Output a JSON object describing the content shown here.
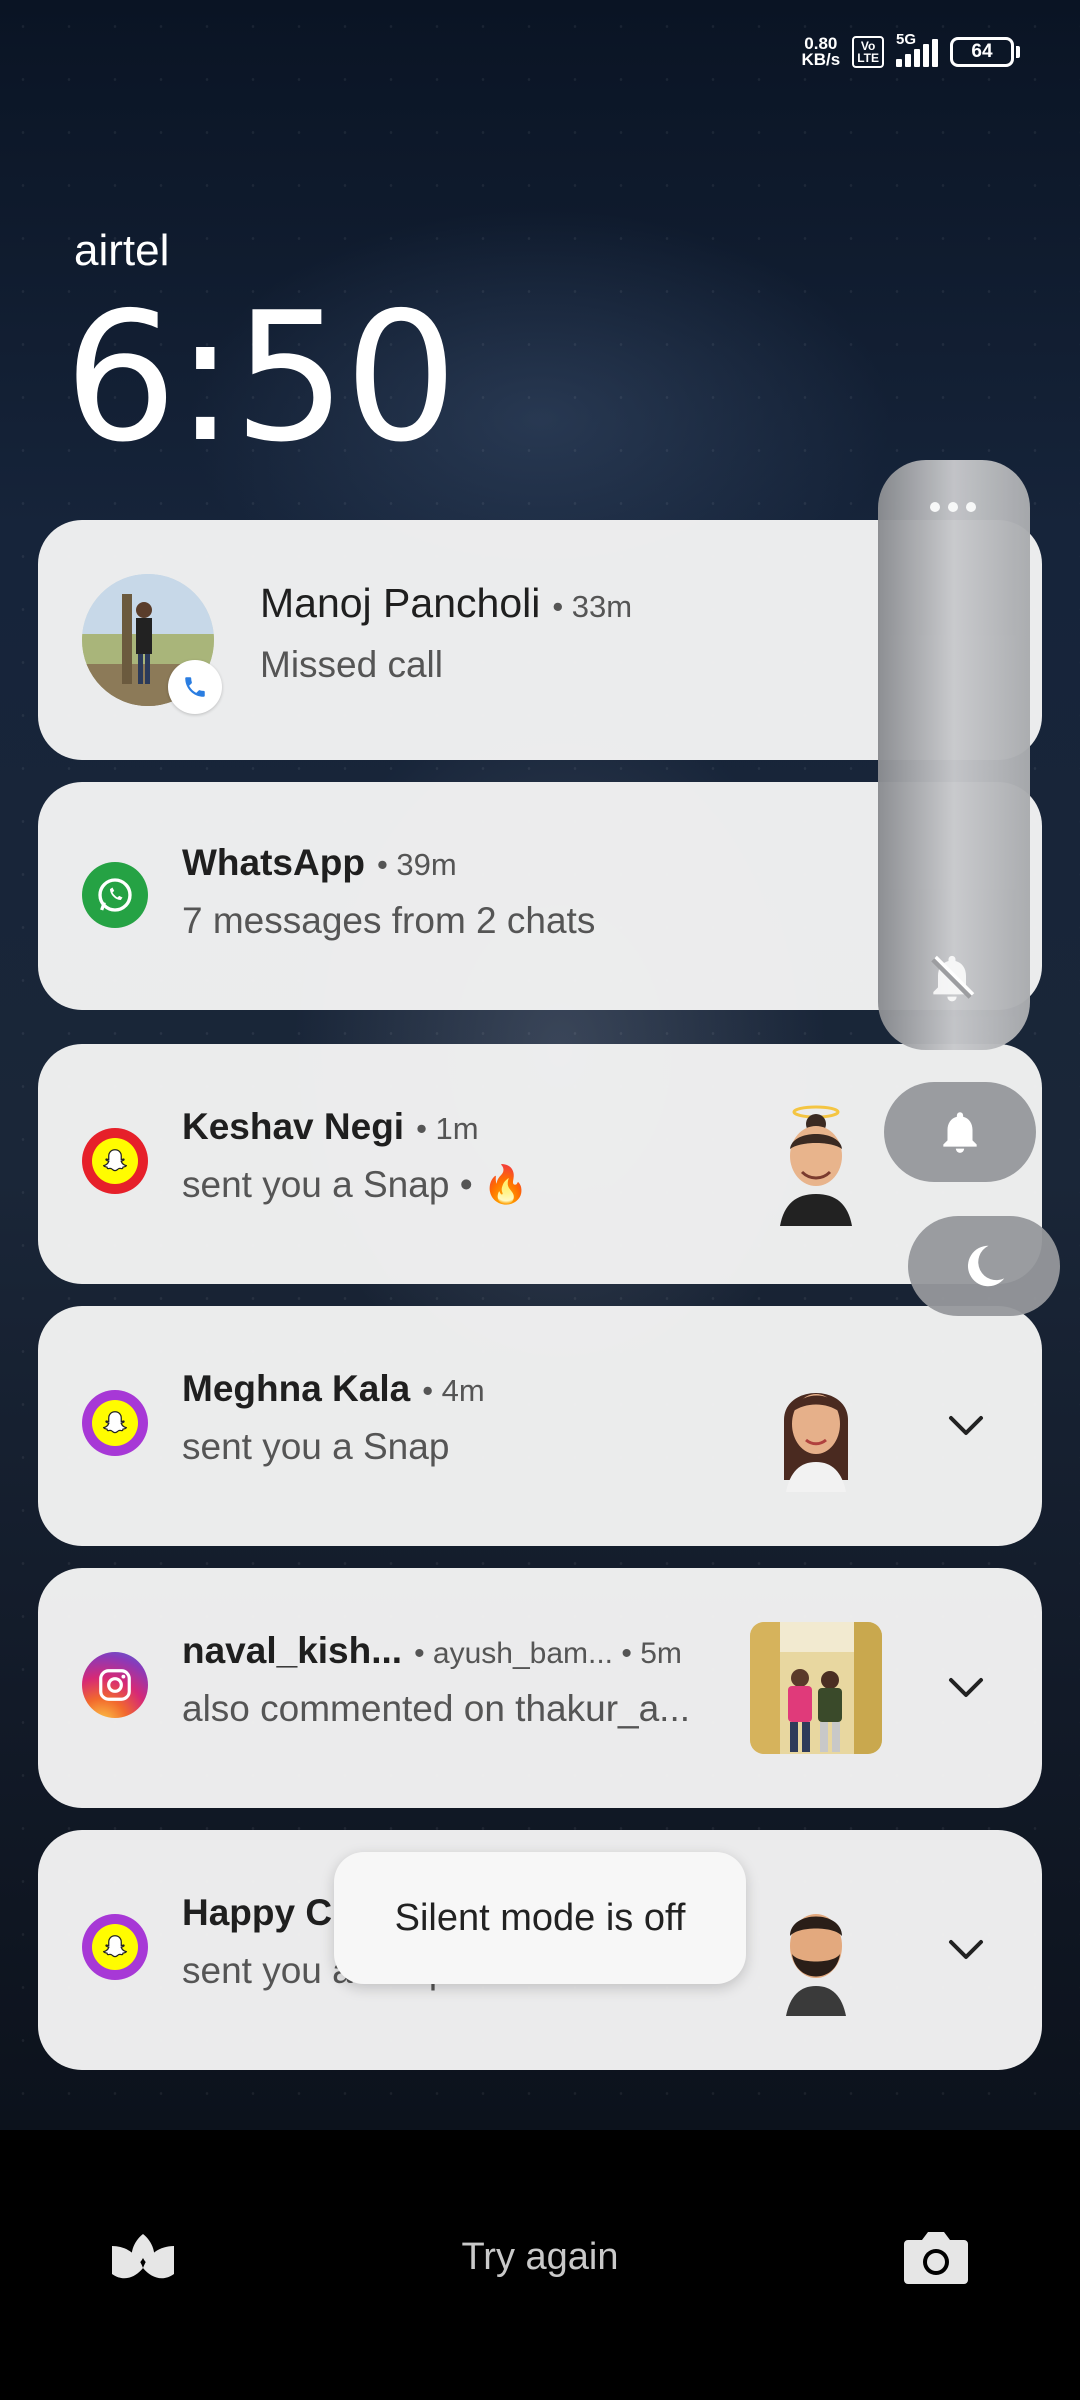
{
  "status_bar": {
    "net_speed_value": "0.80",
    "net_speed_unit": "KB/s",
    "volte_top": "Vo",
    "volte_bottom": "LTE",
    "network": "5G",
    "battery": "64"
  },
  "lockscreen": {
    "carrier": "airtel",
    "time": "6:50"
  },
  "notifications": [
    {
      "name": "Manoj Pancholi",
      "meta": "• 33m",
      "message": "Missed call",
      "icon": "contact-photo"
    },
    {
      "name": "WhatsApp",
      "meta": "• 39m",
      "message": "7 messages from 2 chats",
      "icon": "whatsapp-icon"
    },
    {
      "name": "Keshav Negi",
      "meta": "• 1m",
      "message": "sent you a Snap • 🔥",
      "icon": "snapchat-icon"
    },
    {
      "name": "Meghna Kala",
      "meta": "• 4m",
      "message": "sent you a Snap",
      "icon": "snapchat-icon"
    },
    {
      "name": "naval_kish...",
      "meta": "• ayush_bam... • 5m",
      "message": "also commented on thakur_a...",
      "icon": "instagram-icon"
    },
    {
      "name": "Happy Cl",
      "meta": "",
      "message": "sent you a Snap",
      "icon": "snapchat-icon"
    }
  ],
  "toast": "Silent mode is off",
  "bottom": {
    "try_again": "Try again"
  },
  "colors": {
    "whatsapp": "#25a244",
    "snapchat_yellow": "#fffc00",
    "snapchat_red": "#e6202a",
    "snapchat_purple": "#a738d6"
  }
}
